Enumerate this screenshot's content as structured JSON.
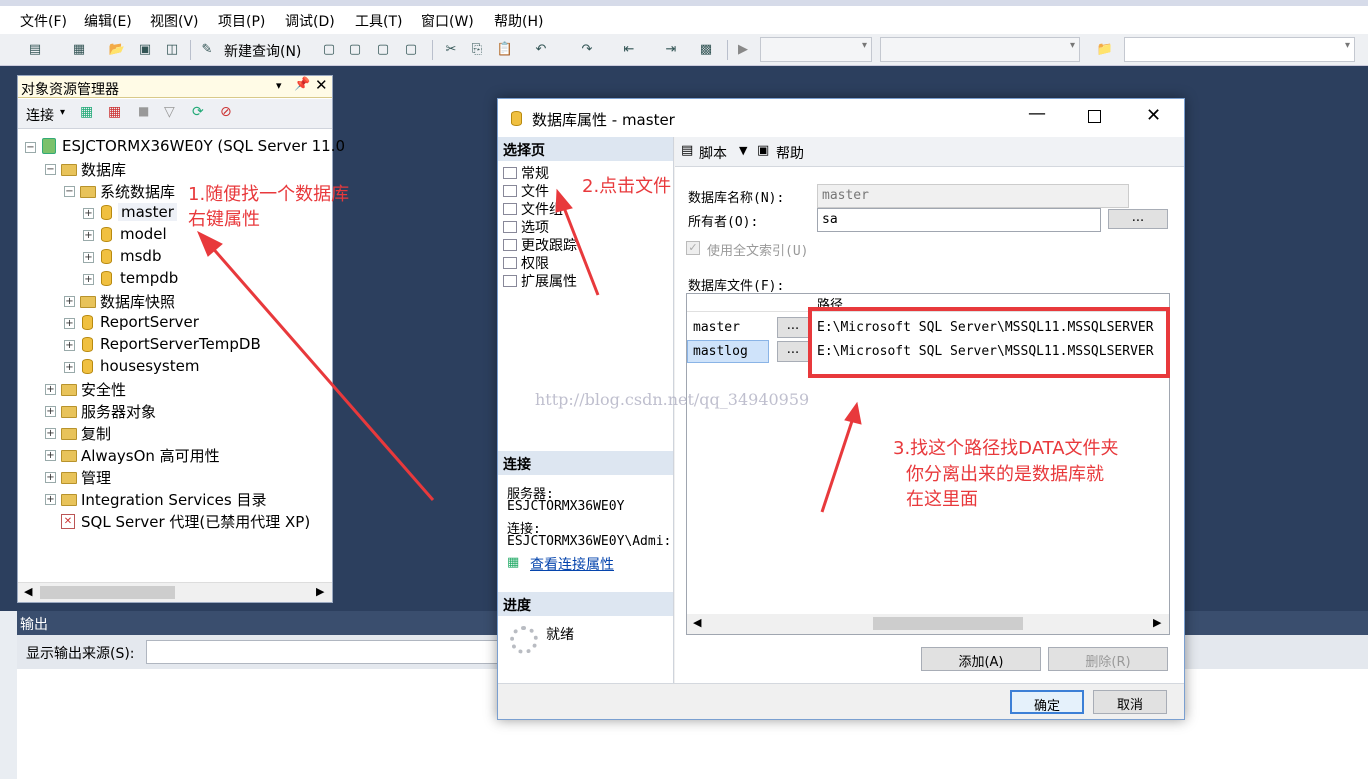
{
  "menu": [
    "文件(F)",
    "编辑(E)",
    "视图(V)",
    "项目(P)",
    "调试(D)",
    "工具(T)",
    "窗口(W)",
    "帮助(H)"
  ],
  "toolbar": {
    "new_query": "新建查询(N)"
  },
  "object_explorer": {
    "title": "对象资源管理器",
    "connect": "连接",
    "server": "ESJCTORMX36WE0Y (SQL Server 11.0",
    "nodes": {
      "databases": "数据库",
      "system_dbs": "系统数据库",
      "master": "master",
      "model": "model",
      "msdb": "msdb",
      "tempdb": "tempdb",
      "snapshots": "数据库快照",
      "reportserver": "ReportServer",
      "reportservertempdb": "ReportServerTempDB",
      "housesystem": "housesystem",
      "security": "安全性",
      "server_objects": "服务器对象",
      "replication": "复制",
      "alwayson": "AlwaysOn 高可用性",
      "management": "管理",
      "integration": "Integration Services 目录",
      "agent": "SQL Server 代理(已禁用代理 XP)"
    }
  },
  "output": {
    "title": "输出",
    "source_label": "显示输出来源(S):"
  },
  "dialog": {
    "title": "数据库属性 - master",
    "select_page": "选择页",
    "pages": [
      "常规",
      "文件",
      "文件组",
      "选项",
      "更改跟踪",
      "权限",
      "扩展属性"
    ],
    "connection_head": "连接",
    "server_label": "服务器:",
    "server_value": "ESJCTORMX36WE0Y",
    "conn_label": "连接:",
    "conn_value": "ESJCTORMX36WE0Y\\Admi:",
    "view_conn": "查看连接属性",
    "progress_head": "进度",
    "progress_status": "就绪",
    "script": "脚本",
    "help": "帮助",
    "db_name_label": "数据库名称(N):",
    "db_name_value": "master",
    "owner_label": "所有者(O):",
    "owner_value": "sa",
    "browse": "...",
    "fulltext": "使用全文索引(U)",
    "files_label": "数据库文件(F):",
    "path_col": "路径",
    "rows": [
      {
        "name": "master",
        "path": "E:\\Microsoft SQL Server\\MSSQL11.MSSQLSERVER"
      },
      {
        "name": "mastlog",
        "path": "E:\\Microsoft SQL Server\\MSSQL11.MSSQLSERVER"
      }
    ],
    "add": "添加(A)",
    "remove": "删除(R)",
    "ok": "确定",
    "cancel": "取消"
  },
  "watermark": "http://blog.csdn.net/qq_34940959",
  "annotations": {
    "a1_line1": "1.随便找一个数据库",
    "a1_line2": "右键属性",
    "a2": "2.点击文件",
    "a3_line1": "3.找这个路径找DATA文件夹",
    "a3_line2": "你分离出来的是数据库就",
    "a3_line3": "在这里面"
  },
  "colors": {
    "annotation": "#e8393c",
    "highlight_box": "#e8393c",
    "workspace": "#2c3f5e"
  }
}
